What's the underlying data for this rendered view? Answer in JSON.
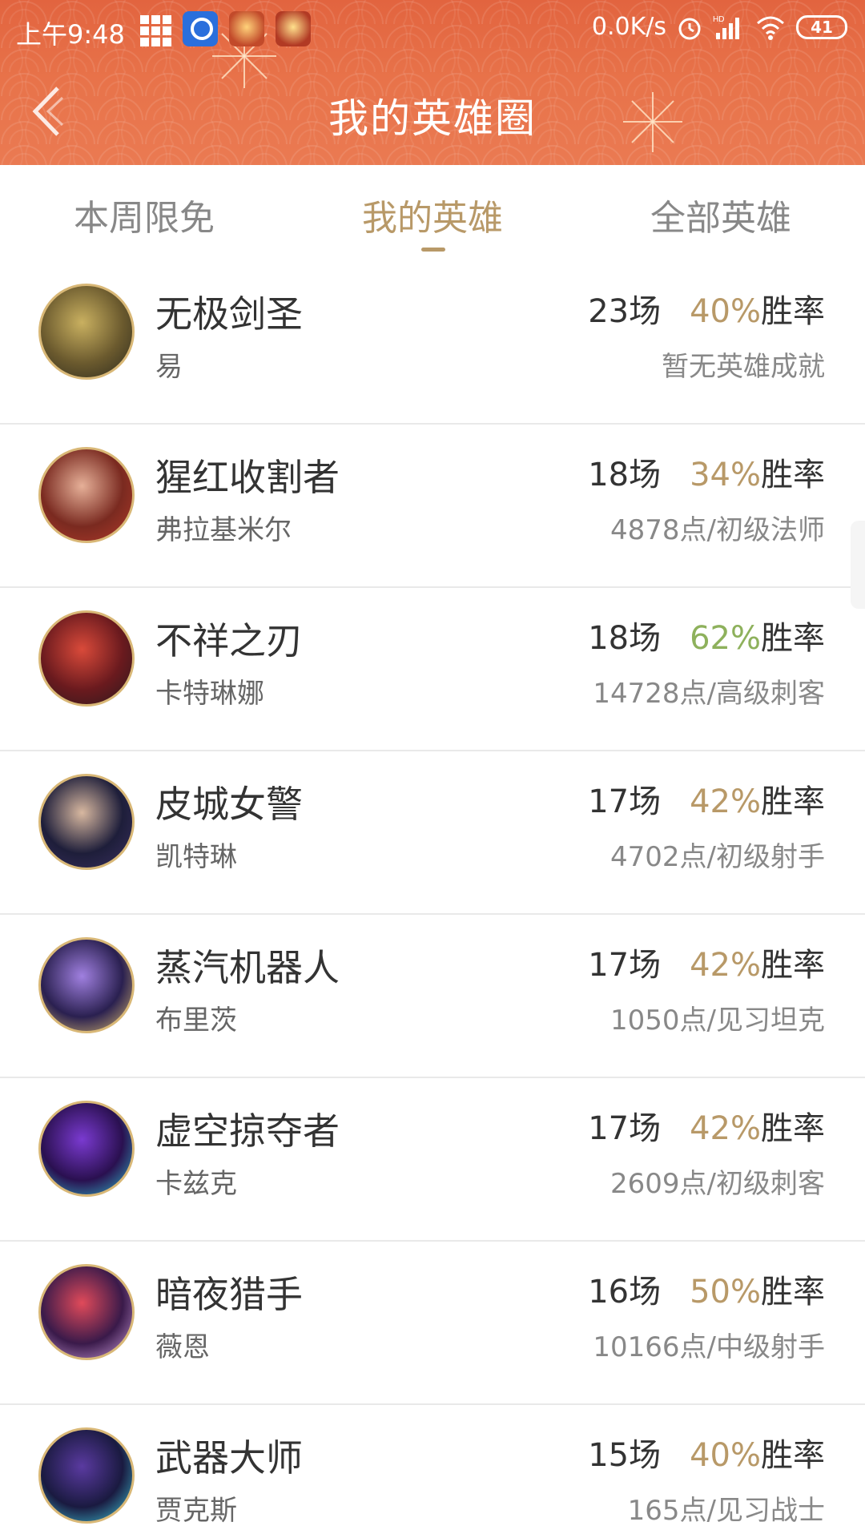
{
  "statusbar": {
    "time": "上午9:48",
    "net_speed": "0.0K/s",
    "battery": "41",
    "icons": [
      "grid-icon",
      "browser-app-icon",
      "game-app-icon",
      "game-app-icon",
      "alarm-icon",
      "signal-icon",
      "wifi-icon",
      "battery-icon"
    ]
  },
  "header": {
    "title": "我的英雄圈",
    "back_icon": "chevron-left-icon",
    "bg_color": "#e8734a"
  },
  "tabs": [
    {
      "label": "本周限免",
      "active": false
    },
    {
      "label": "我的英雄",
      "active": true
    },
    {
      "label": "全部英雄",
      "active": false
    }
  ],
  "colors": {
    "accent": "#b89968",
    "win_green": "#8eb15c"
  },
  "heroes": [
    {
      "name": "无极剑圣",
      "real": "易",
      "games": "23场",
      "rate": "40%",
      "rate_label": "胜率",
      "achievement": "暂无英雄成就",
      "avatar": [
        "#6b5a2e",
        "#c9b060",
        "#2c2a1e"
      ]
    },
    {
      "name": "猩红收割者",
      "real": "弗拉基米尔",
      "games": "18场",
      "rate": "34%",
      "rate_label": "胜率",
      "achievement": "4878点/初级法师",
      "avatar": [
        "#7a2a20",
        "#e6b098",
        "#b23a2a"
      ]
    },
    {
      "name": "不祥之刃",
      "real": "卡特琳娜",
      "games": "18场",
      "rate": "62%",
      "rate_label": "胜率",
      "achievement": "14728点/高级刺客",
      "green": true,
      "avatar": [
        "#6a1a1e",
        "#d94a3a",
        "#2a1a1e"
      ]
    },
    {
      "name": "皮城女警",
      "real": "凯特琳",
      "games": "17场",
      "rate": "42%",
      "rate_label": "胜率",
      "achievement": "4702点/初级射手",
      "avatar": [
        "#1e1e3a",
        "#d8b8a0",
        "#3a3060"
      ]
    },
    {
      "name": "蒸汽机器人",
      "real": "布里茨",
      "games": "17场",
      "rate": "42%",
      "rate_label": "胜率",
      "achievement": "1050点/见习坦克",
      "avatar": [
        "#2a2050",
        "#a080e0",
        "#e0c070"
      ]
    },
    {
      "name": "虚空掠夺者",
      "real": "卡兹克",
      "games": "17场",
      "rate": "42%",
      "rate_label": "胜率",
      "achievement": "2609点/初级刺客",
      "avatar": [
        "#2a1050",
        "#7a3ad0",
        "#30c0d0"
      ]
    },
    {
      "name": "暗夜猎手",
      "real": "薇恩",
      "games": "16场",
      "rate": "50%",
      "rate_label": "胜率",
      "achievement": "10166点/中级射手",
      "avatar": [
        "#3a1a4a",
        "#e04a5a",
        "#d0a0e0"
      ]
    },
    {
      "name": "武器大师",
      "real": "贾克斯",
      "games": "15场",
      "rate": "40%",
      "rate_label": "胜率",
      "achievement": "165点/见习战士",
      "avatar": [
        "#1a1a40",
        "#5a3aa0",
        "#40d0e0"
      ]
    }
  ]
}
